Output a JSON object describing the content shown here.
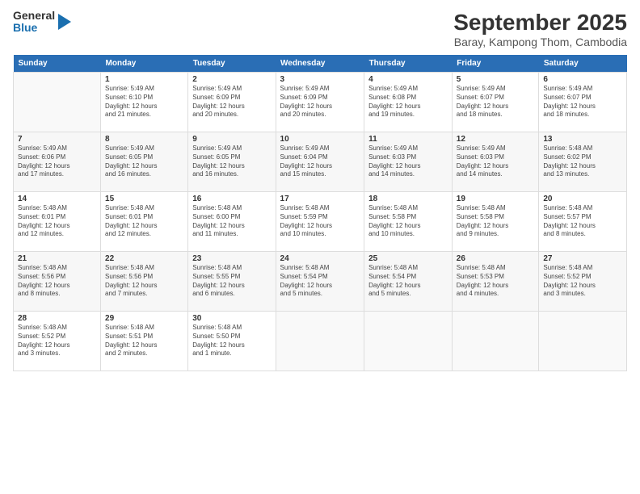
{
  "logo": {
    "general": "General",
    "blue": "Blue"
  },
  "title": "September 2025",
  "subtitle": "Baray, Kampong Thom, Cambodia",
  "days_header": [
    "Sunday",
    "Monday",
    "Tuesday",
    "Wednesday",
    "Thursday",
    "Friday",
    "Saturday"
  ],
  "weeks": [
    [
      {
        "day": "",
        "content": ""
      },
      {
        "day": "1",
        "content": "Sunrise: 5:49 AM\nSunset: 6:10 PM\nDaylight: 12 hours\nand 21 minutes."
      },
      {
        "day": "2",
        "content": "Sunrise: 5:49 AM\nSunset: 6:09 PM\nDaylight: 12 hours\nand 20 minutes."
      },
      {
        "day": "3",
        "content": "Sunrise: 5:49 AM\nSunset: 6:09 PM\nDaylight: 12 hours\nand 20 minutes."
      },
      {
        "day": "4",
        "content": "Sunrise: 5:49 AM\nSunset: 6:08 PM\nDaylight: 12 hours\nand 19 minutes."
      },
      {
        "day": "5",
        "content": "Sunrise: 5:49 AM\nSunset: 6:07 PM\nDaylight: 12 hours\nand 18 minutes."
      },
      {
        "day": "6",
        "content": "Sunrise: 5:49 AM\nSunset: 6:07 PM\nDaylight: 12 hours\nand 18 minutes."
      }
    ],
    [
      {
        "day": "7",
        "content": "Sunrise: 5:49 AM\nSunset: 6:06 PM\nDaylight: 12 hours\nand 17 minutes."
      },
      {
        "day": "8",
        "content": "Sunrise: 5:49 AM\nSunset: 6:05 PM\nDaylight: 12 hours\nand 16 minutes."
      },
      {
        "day": "9",
        "content": "Sunrise: 5:49 AM\nSunset: 6:05 PM\nDaylight: 12 hours\nand 16 minutes."
      },
      {
        "day": "10",
        "content": "Sunrise: 5:49 AM\nSunset: 6:04 PM\nDaylight: 12 hours\nand 15 minutes."
      },
      {
        "day": "11",
        "content": "Sunrise: 5:49 AM\nSunset: 6:03 PM\nDaylight: 12 hours\nand 14 minutes."
      },
      {
        "day": "12",
        "content": "Sunrise: 5:49 AM\nSunset: 6:03 PM\nDaylight: 12 hours\nand 14 minutes."
      },
      {
        "day": "13",
        "content": "Sunrise: 5:48 AM\nSunset: 6:02 PM\nDaylight: 12 hours\nand 13 minutes."
      }
    ],
    [
      {
        "day": "14",
        "content": "Sunrise: 5:48 AM\nSunset: 6:01 PM\nDaylight: 12 hours\nand 12 minutes."
      },
      {
        "day": "15",
        "content": "Sunrise: 5:48 AM\nSunset: 6:01 PM\nDaylight: 12 hours\nand 12 minutes."
      },
      {
        "day": "16",
        "content": "Sunrise: 5:48 AM\nSunset: 6:00 PM\nDaylight: 12 hours\nand 11 minutes."
      },
      {
        "day": "17",
        "content": "Sunrise: 5:48 AM\nSunset: 5:59 PM\nDaylight: 12 hours\nand 10 minutes."
      },
      {
        "day": "18",
        "content": "Sunrise: 5:48 AM\nSunset: 5:58 PM\nDaylight: 12 hours\nand 10 minutes."
      },
      {
        "day": "19",
        "content": "Sunrise: 5:48 AM\nSunset: 5:58 PM\nDaylight: 12 hours\nand 9 minutes."
      },
      {
        "day": "20",
        "content": "Sunrise: 5:48 AM\nSunset: 5:57 PM\nDaylight: 12 hours\nand 8 minutes."
      }
    ],
    [
      {
        "day": "21",
        "content": "Sunrise: 5:48 AM\nSunset: 5:56 PM\nDaylight: 12 hours\nand 8 minutes."
      },
      {
        "day": "22",
        "content": "Sunrise: 5:48 AM\nSunset: 5:56 PM\nDaylight: 12 hours\nand 7 minutes."
      },
      {
        "day": "23",
        "content": "Sunrise: 5:48 AM\nSunset: 5:55 PM\nDaylight: 12 hours\nand 6 minutes."
      },
      {
        "day": "24",
        "content": "Sunrise: 5:48 AM\nSunset: 5:54 PM\nDaylight: 12 hours\nand 5 minutes."
      },
      {
        "day": "25",
        "content": "Sunrise: 5:48 AM\nSunset: 5:54 PM\nDaylight: 12 hours\nand 5 minutes."
      },
      {
        "day": "26",
        "content": "Sunrise: 5:48 AM\nSunset: 5:53 PM\nDaylight: 12 hours\nand 4 minutes."
      },
      {
        "day": "27",
        "content": "Sunrise: 5:48 AM\nSunset: 5:52 PM\nDaylight: 12 hours\nand 3 minutes."
      }
    ],
    [
      {
        "day": "28",
        "content": "Sunrise: 5:48 AM\nSunset: 5:52 PM\nDaylight: 12 hours\nand 3 minutes."
      },
      {
        "day": "29",
        "content": "Sunrise: 5:48 AM\nSunset: 5:51 PM\nDaylight: 12 hours\nand 2 minutes."
      },
      {
        "day": "30",
        "content": "Sunrise: 5:48 AM\nSunset: 5:50 PM\nDaylight: 12 hours\nand 1 minute."
      },
      {
        "day": "",
        "content": ""
      },
      {
        "day": "",
        "content": ""
      },
      {
        "day": "",
        "content": ""
      },
      {
        "day": "",
        "content": ""
      }
    ]
  ]
}
